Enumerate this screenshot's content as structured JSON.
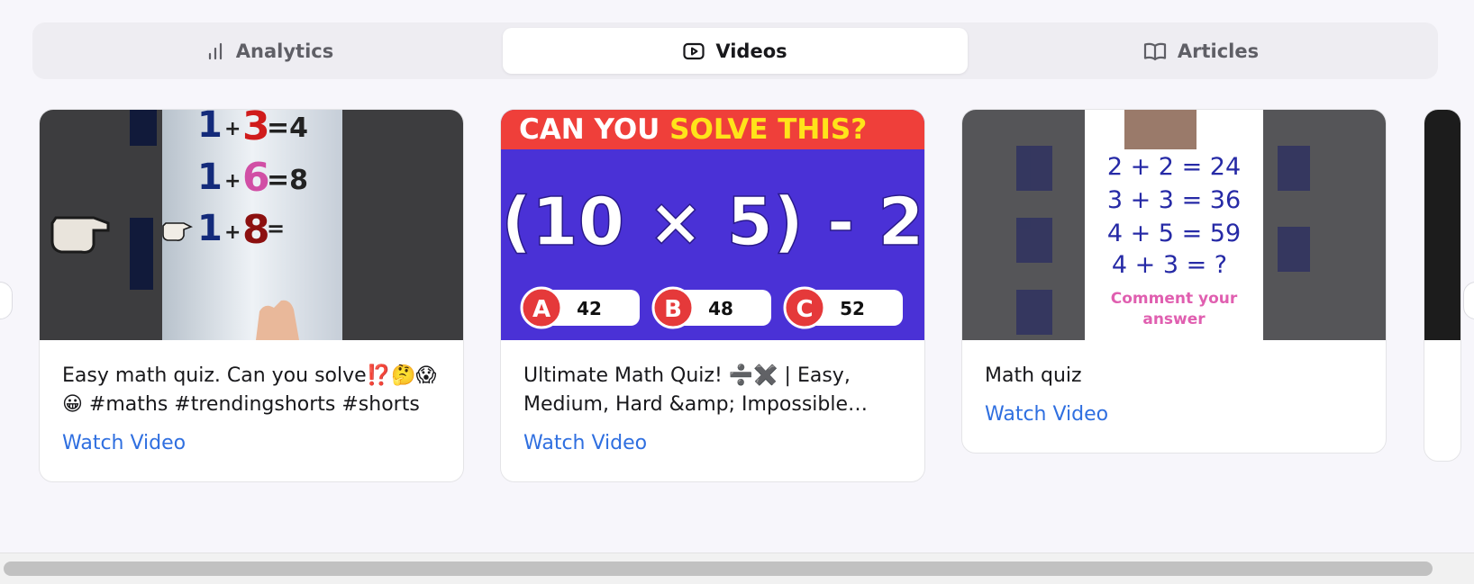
{
  "tabs": [
    {
      "label": "Analytics",
      "icon": "bar-chart-icon",
      "active": false
    },
    {
      "label": "Videos",
      "icon": "play-icon",
      "active": true
    },
    {
      "label": "Articles",
      "icon": "book-open-icon",
      "active": false
    }
  ],
  "cards": [
    {
      "title": "Easy math quiz. Can you solve⁉️🤔😱😀 #maths #trendingshorts #shorts",
      "link": "Watch Video",
      "thumb": {
        "rows": [
          [
            "1",
            "+",
            "3",
            "=4"
          ],
          [
            "1",
            "+",
            "6",
            "=8"
          ],
          [
            "1",
            "+",
            "8",
            "="
          ]
        ]
      }
    },
    {
      "title": "Ultimate Math Quiz! ➗✖️ | Easy, Medium, Hard &amp; Impossible…",
      "link": "Watch Video",
      "thumb": {
        "banner_1": "CAN YOU ",
        "banner_2": "SOLVE THIS?",
        "equation": "(10 × 5) - 2",
        "options": [
          {
            "letter": "A",
            "value": "42"
          },
          {
            "letter": "B",
            "value": "48"
          },
          {
            "letter": "C",
            "value": "52"
          }
        ]
      }
    },
    {
      "title": "Math quiz",
      "link": "Watch Video",
      "thumb": {
        "lines": [
          "2 + 2 = 24",
          "3 + 3 = 36",
          "4 + 5 = 59",
          "4 + 3 = ?"
        ],
        "cta_1": "Comment your",
        "cta_2": "answer"
      }
    }
  ],
  "colors": {
    "accent_link": "#2f6fe0",
    "active_tab_bg": "#ffffff",
    "tab_bar_bg": "#eeedf2",
    "quiz_purple": "#4a31d6",
    "quiz_red": "#ef3f3a",
    "quiz_yellow": "#ffe31a"
  }
}
